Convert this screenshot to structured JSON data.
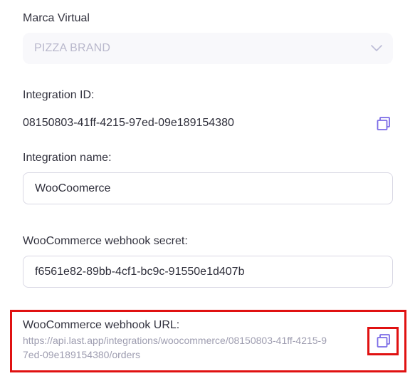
{
  "brand": {
    "label": "Marca Virtual",
    "selected": "PIZZA BRAND"
  },
  "integration_id": {
    "label": "Integration ID:",
    "value": "08150803-41ff-4215-97ed-09e189154380"
  },
  "integration_name": {
    "label": "Integration name:",
    "value": "WooCoomerce"
  },
  "webhook_secret": {
    "label": "WooCommerce webhook secret:",
    "value": "f6561e82-89bb-4cf1-bc9c-91550e1d407b"
  },
  "webhook_url": {
    "label": "WooCommerce webhook URL:",
    "value": "https://api.last.app/integrations/woocommerce/08150803-41ff-4215-97ed-09e189154380/orders"
  },
  "colors": {
    "accent": "#6c5ce7",
    "highlight": "#e01111"
  },
  "icons": {
    "chevron": "chevron-down-icon",
    "copy": "copy-icon"
  }
}
